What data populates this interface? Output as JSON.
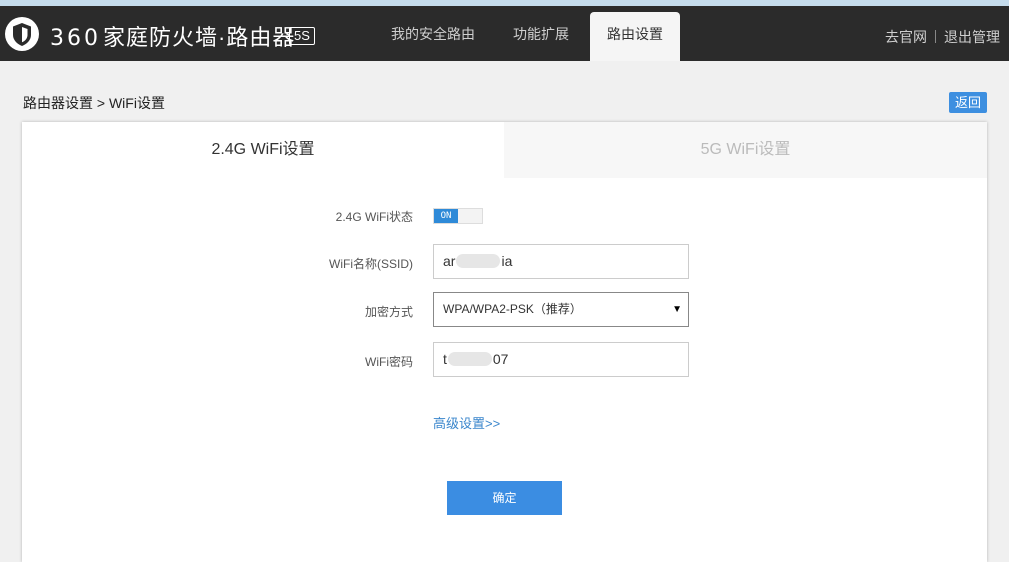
{
  "header": {
    "brand_number": "360",
    "brand_title": "家庭防火墙·路由器",
    "model_badge": "5S",
    "nav": [
      {
        "label": "我的安全路由",
        "active": false
      },
      {
        "label": "功能扩展",
        "active": false
      },
      {
        "label": "路由设置",
        "active": true
      }
    ],
    "links": {
      "official_site": "去官网",
      "logout": "退出管理"
    }
  },
  "breadcrumb": "路由器设置 > WiFi设置",
  "back_label": "返回",
  "tabs": [
    {
      "label": "2.4G WiFi设置",
      "active": true
    },
    {
      "label": "5G WiFi设置",
      "active": false
    }
  ],
  "form": {
    "status_label": "2.4G WiFi状态",
    "status_toggle": "ON",
    "ssid_label": "WiFi名称(SSID)",
    "ssid_value_start": "ar",
    "ssid_value_end": "ia",
    "encryption_label": "加密方式",
    "encryption_value": "WPA/WPA2-PSK（推荐）",
    "password_label": "WiFi密码",
    "password_value_start": "t",
    "password_value_end": "07",
    "advanced_link": "高级设置>>",
    "confirm_label": "确定"
  },
  "colors": {
    "header_bg": "#2b2b2b",
    "accent": "#3b8de2",
    "link": "#3a86cc"
  },
  "icons": [
    "shield-logo-icon",
    "dropdown-caret-icon"
  ]
}
